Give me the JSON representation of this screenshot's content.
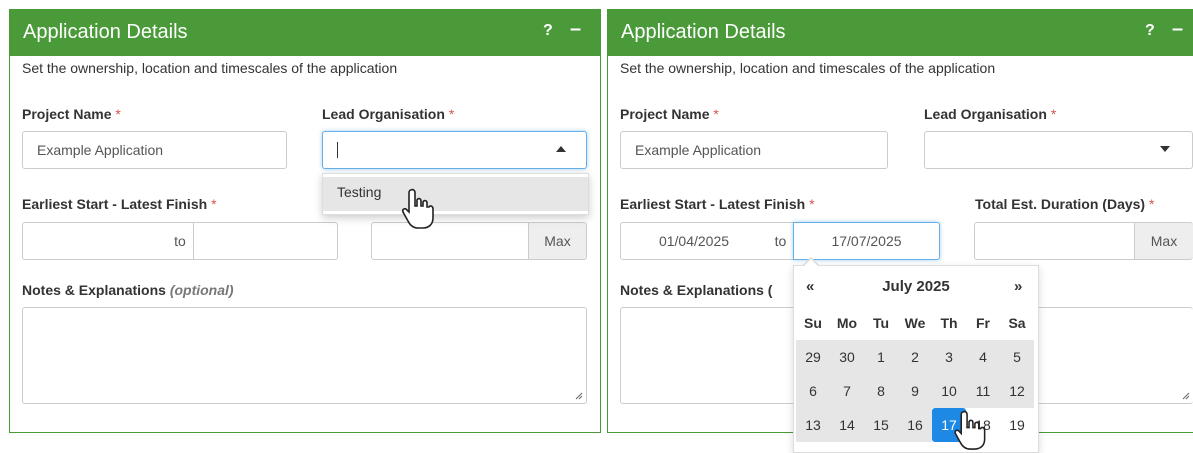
{
  "colors": {
    "header_green": "#4a9a3a",
    "required_red": "#d9534f",
    "active_blue": "#1e88e5"
  },
  "left_panel": {
    "title": "Application Details",
    "help": "?",
    "collapse": "–",
    "subtitle": "Set the ownership, location and timescales of the application",
    "project_name_label": "Project Name",
    "lead_org_label": "Lead Organisation",
    "required_mark": "*",
    "project_name_value": "Example Application",
    "lead_org_dropdown_option": "Testing",
    "dates_label": "Earliest Start - Latest Finish",
    "to_label": "to",
    "max_label": "Max",
    "notes_label": "Notes & Explanations",
    "notes_optional": "(optional)"
  },
  "right_panel": {
    "title": "Application Details",
    "help": "?",
    "collapse": "–",
    "subtitle": "Set the ownership, location and timescales of the application",
    "project_name_label": "Project Name",
    "lead_org_label": "Lead Organisation",
    "required_mark": "*",
    "project_name_value": "Example Application",
    "dates_label": "Earliest Start - Latest Finish",
    "duration_label": "Total Est. Duration (Days)",
    "start_date": "01/04/2025",
    "to_label": "to",
    "end_date": "17/07/2025",
    "max_label": "Max",
    "notes_label": "Notes & Explanations (",
    "icons": [
      "chevron-down-icon",
      "hand-pointer-icon",
      "resize-grip-icon"
    ]
  },
  "datepicker": {
    "prev": "«",
    "next": "»",
    "month_title": "July 2025",
    "weekdays": [
      "Su",
      "Mo",
      "Tu",
      "We",
      "Th",
      "Fr",
      "Sa"
    ],
    "weeks": [
      [
        "29",
        "30",
        "1",
        "2",
        "3",
        "4",
        "5"
      ],
      [
        "6",
        "7",
        "8",
        "9",
        "10",
        "11",
        "12"
      ],
      [
        "13",
        "14",
        "15",
        "16",
        "17",
        "18",
        "19"
      ]
    ],
    "selected_day": "17"
  }
}
